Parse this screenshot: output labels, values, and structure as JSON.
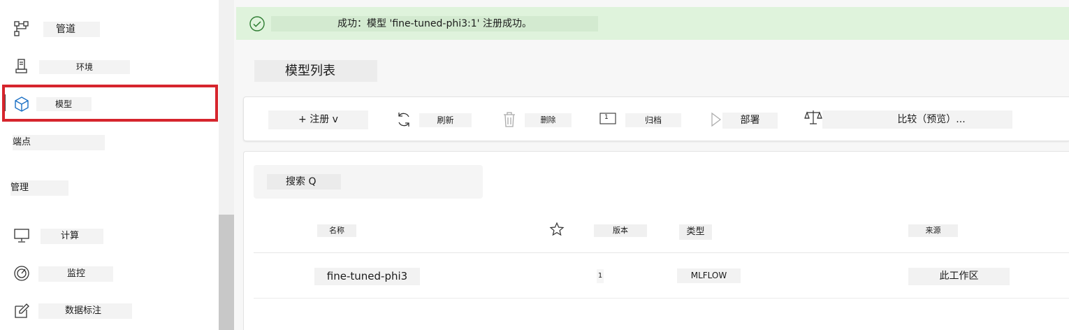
{
  "sidebar": {
    "items": [
      {
        "label": "管道",
        "icon": "pipeline-icon"
      },
      {
        "label": "环境",
        "icon": "environment-icon"
      },
      {
        "label": "模型",
        "icon": "cube-icon"
      },
      {
        "label": "计算",
        "icon": "monitor-icon"
      },
      {
        "label": "监控",
        "icon": "gauge-icon"
      },
      {
        "label": "数据标注",
        "icon": "edit-icon"
      }
    ],
    "sections": {
      "endpoints": "端点",
      "manage": "管理"
    }
  },
  "banner": {
    "message": "成功：模型 'fine-tuned-phi3:1' 注册成功。",
    "status_color": "#dff3dc"
  },
  "page": {
    "title": "模型列表"
  },
  "toolbar": {
    "register": "+ 注册 v",
    "refresh": "刷新",
    "delete": "删除",
    "archive_badge": "1",
    "archive": "归档",
    "deploy": "部署",
    "compare": "比较（预览）..."
  },
  "search": {
    "label": "搜索 Q"
  },
  "table": {
    "columns": {
      "name": "名称",
      "version": "版本",
      "type": "类型",
      "source": "来源"
    },
    "rows": [
      {
        "name": "fine-tuned-phi3",
        "version": "1",
        "type": "MLFLOW",
        "source": "此工作区"
      }
    ]
  },
  "colors": {
    "highlight": "#d6252d",
    "success": "#2e7d32"
  }
}
